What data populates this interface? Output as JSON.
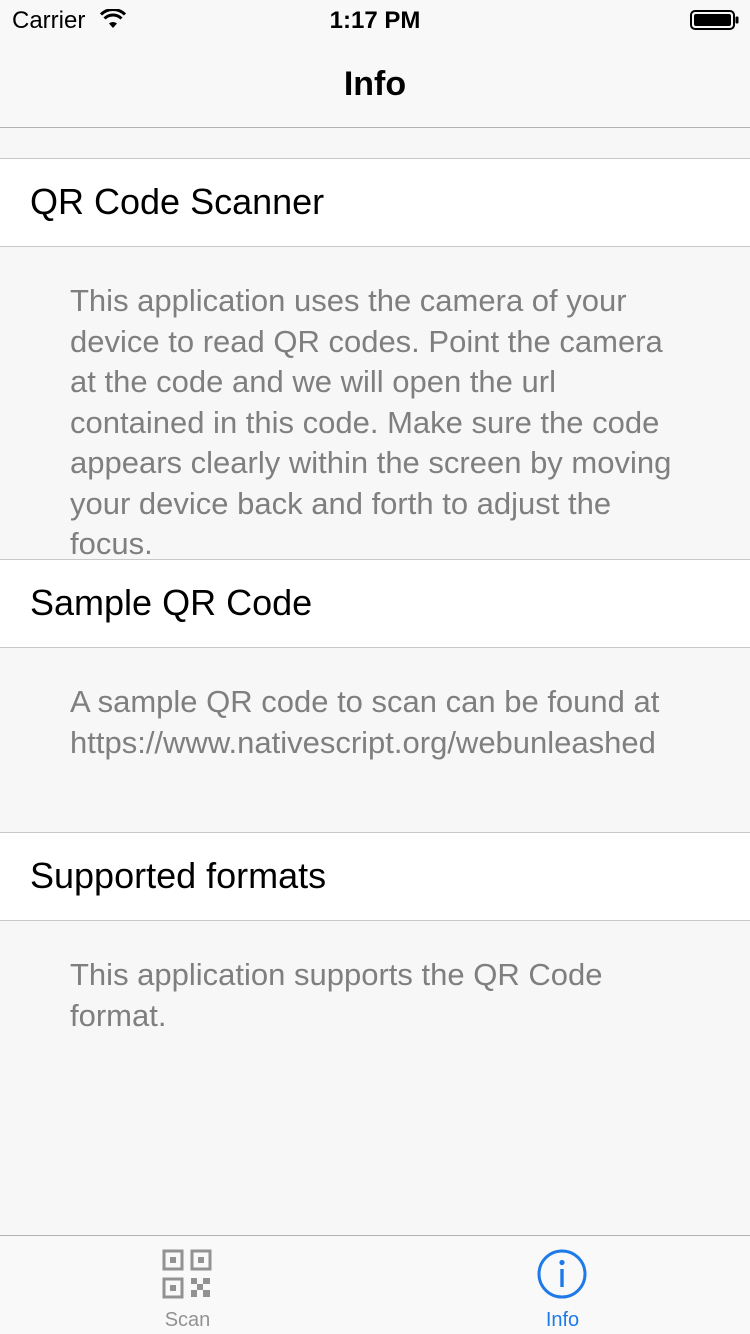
{
  "status_bar": {
    "carrier": "Carrier",
    "time": "1:17 PM"
  },
  "nav": {
    "title": "Info"
  },
  "sections": [
    {
      "title": "QR Code Scanner",
      "body": "This application uses the camera of your device to read QR codes. Point the camera at the code and we will open the url contained in this code. Make sure the code appears clearly within the screen by moving your device back and forth to adjust the focus."
    },
    {
      "title": "Sample QR Code",
      "body": "A sample QR code to scan can be found at https://www.nativescript.org/webunleashed"
    },
    {
      "title": "Supported formats",
      "body": "This application supports the QR Code format."
    }
  ],
  "tabs": [
    {
      "label": "Scan",
      "icon": "qr-code-icon",
      "active": false
    },
    {
      "label": "Info",
      "icon": "info-icon",
      "active": true
    }
  ],
  "colors": {
    "accent": "#1e7ae8",
    "inactive_tab": "#929292",
    "body_text": "#7f7f7f",
    "background": "#f7f7f7"
  }
}
